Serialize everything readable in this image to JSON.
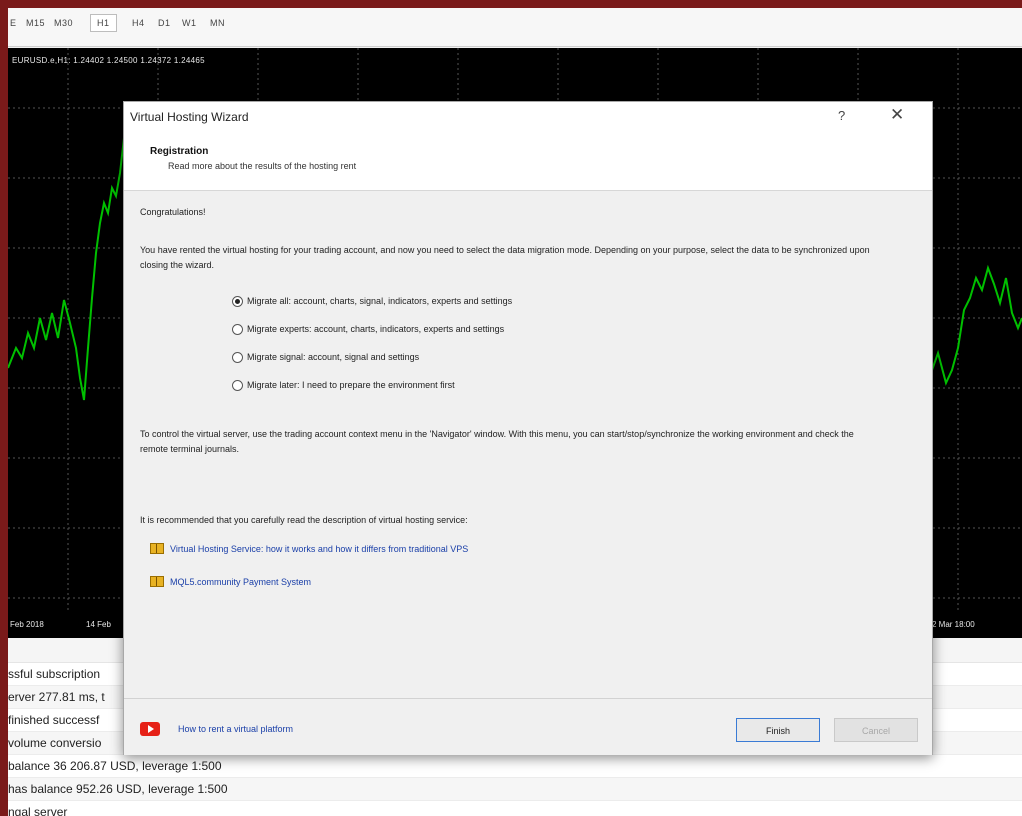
{
  "toolbar": {
    "timeframes": [
      "E",
      "M15",
      "M30",
      "H1",
      "H4",
      "D1",
      "W1",
      "MN"
    ],
    "active": "H1"
  },
  "chart": {
    "symbol_line": "EURUSD.e,H1: 1.24402 1.24500 1.24372 1.24465",
    "dates": [
      "Feb 2018",
      "14 Feb",
      "2 Mar 18:00"
    ],
    "line_color": "#00c000"
  },
  "journal": {
    "rows": [
      "ssful subscription",
      "erver 277.81 ms, t",
      " finished successf",
      "volume conversio",
      "balance 36 206.87 USD, leverage 1:500",
      " has balance 952.26 USD, leverage 1:500",
      "ngal server"
    ]
  },
  "dialog": {
    "title": "Virtual Hosting Wizard",
    "help": "?",
    "close": "✕",
    "header_title": "Registration",
    "header_subtitle": "Read more about the results of the hosting rent",
    "congrats": "Congratulations!",
    "intro": "You have rented the virtual hosting for your trading account, and now you need to select the data migration mode. Depending on your purpose, select the data to be synchronized upon closing the wizard.",
    "options": [
      {
        "label": "Migrate all: account, charts, signal, indicators, experts and settings",
        "selected": true
      },
      {
        "label": "Migrate experts: account, charts, indicators, experts and settings",
        "selected": false
      },
      {
        "label": "Migrate signal: account, signal and settings",
        "selected": false
      },
      {
        "label": "Migrate later: I need to prepare the environment first",
        "selected": false
      }
    ],
    "control_text": "To control the virtual server, use the trading account context menu in the 'Navigator' window. With this menu, you can start/stop/synchronize the working environment and check the remote terminal journals.",
    "recommend": "It is recommended that you carefully read the description of virtual hosting service:",
    "links": [
      "Virtual Hosting Service: how it works and how it differs from traditional VPS",
      "MQL5.community Payment System"
    ],
    "video_link": "How to rent a virtual platform",
    "finish": "Finish",
    "cancel": "Cancel"
  }
}
